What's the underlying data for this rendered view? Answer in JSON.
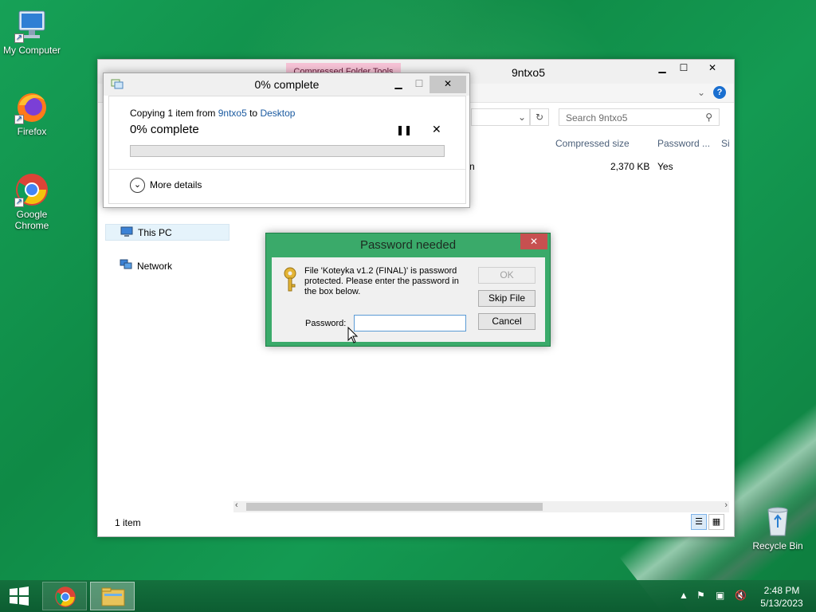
{
  "desktop": {
    "icons": [
      {
        "label": "My Computer",
        "icon": "computer-icon"
      },
      {
        "label": "Firefox",
        "icon": "firefox-icon"
      },
      {
        "label": "Google Chrome",
        "icon": "chrome-icon"
      },
      {
        "label": "Recycle Bin",
        "icon": "recycle-bin-icon"
      }
    ]
  },
  "explorer": {
    "title": "9ntxo5",
    "context_tab": "Compressed Folder Tools",
    "search_placeholder": "Search 9ntxo5",
    "columns": [
      "Compressed size",
      "Password ...",
      "Si"
    ],
    "row": {
      "name_tail": "n",
      "compressed_size": "2,370 KB",
      "password": "Yes"
    },
    "nav": {
      "this_pc": "This PC",
      "network": "Network"
    },
    "status": "1 item"
  },
  "copy_dialog": {
    "title": "0% complete",
    "copying_prefix": "Copying 1 item from",
    "source": "9ntxo5",
    "to_word": "to",
    "destination": "Desktop",
    "status": "0% complete",
    "progress": 0,
    "more_details": "More details"
  },
  "password_dialog": {
    "title": "Password needed",
    "message": "File 'Koteyka v1.2 (FINAL)' is password protected.  Please enter the password in the box below.",
    "ok_label": "OK",
    "skip_label": "Skip File",
    "cancel_label": "Cancel",
    "password_label": "Password:",
    "password_value": ""
  },
  "taskbar": {
    "time": "2:48 PM",
    "date": "5/13/2023",
    "pinned": [
      "chrome-icon",
      "file-explorer-icon"
    ]
  },
  "colors": {
    "accent_green": "#3aaa6a",
    "close_red": "#c75050",
    "link_blue": "#1a5aa0",
    "progress_green": "#06b025"
  }
}
